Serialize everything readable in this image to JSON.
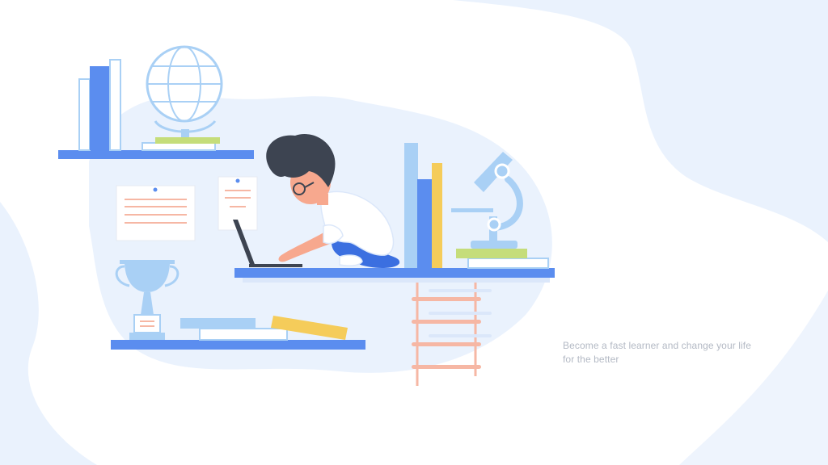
{
  "caption": {
    "text": "Become a fast learner and change your life for the better"
  },
  "palette": {
    "blob_light": "#eaf2fd",
    "shelf_blue": "#5b8def",
    "book_light_blue": "#a9d0f5",
    "book_yellow": "#f5cc5a",
    "book_green": "#c5dd7a",
    "ladder_pink": "#f6b7a4",
    "hair": "#3d4451",
    "skin": "#f7a88e",
    "pants": "#3b6fe0"
  },
  "illustration": {
    "subject": "boy-studying-on-laptop",
    "objects": [
      "globe-icon",
      "trophy-icon",
      "microscope-icon",
      "laptop-icon",
      "ladder-icon",
      "books-icon",
      "note-icon"
    ]
  }
}
